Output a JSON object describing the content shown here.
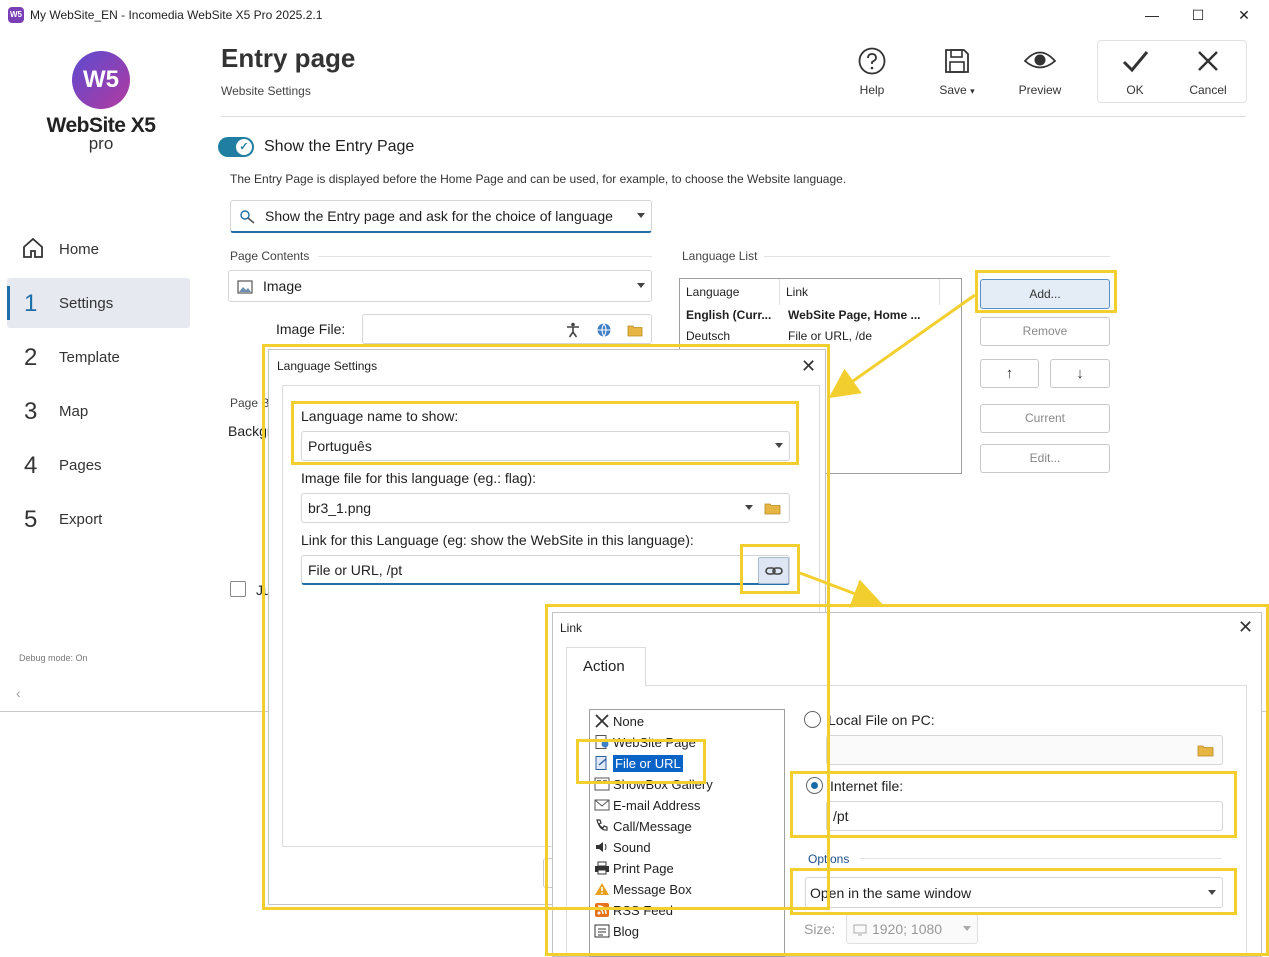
{
  "window": {
    "title": "My WebSite_EN - Incomedia WebSite X5 Pro 2025.2.1",
    "app_icon_text": "W5",
    "minimize": "—",
    "maximize": "☐",
    "close": "✕"
  },
  "logo": {
    "mark": "W5",
    "name": "WebSite X5",
    "edition": "pro"
  },
  "nav": [
    {
      "num": "",
      "label": "Home"
    },
    {
      "num": "1",
      "label": "Settings"
    },
    {
      "num": "2",
      "label": "Template"
    },
    {
      "num": "3",
      "label": "Map"
    },
    {
      "num": "4",
      "label": "Pages"
    },
    {
      "num": "5",
      "label": "Export"
    }
  ],
  "debug_mode": "Debug mode: On",
  "collapse_glyph": "‹",
  "header": {
    "title": "Entry page",
    "subtitle": "Website Settings"
  },
  "toolbar": {
    "help": "Help",
    "save": "Save",
    "save_caret": "▾",
    "preview": "Preview",
    "ok": "OK",
    "cancel": "Cancel"
  },
  "entry": {
    "toggle_label": "Show the Entry Page",
    "toggle_check": "✓",
    "description": "The Entry Page is displayed before the Home Page and can be used, for example, to choose the Website language.",
    "mode_value": "Show the Entry page and ask for the choice of language",
    "page_contents_label": "Page Contents",
    "page_contents_value": "Image",
    "image_file_label": "Image File:",
    "image_file_value": "",
    "page_bg_label_partial": "Page Ba",
    "background_label_partial": "Backgr",
    "checkbox_label_partial": "Ju"
  },
  "language_list": {
    "label": "Language List",
    "columns": [
      "Language",
      "Link"
    ],
    "rows": [
      {
        "language": "English (Curr...",
        "link": "WebSite Page, Home ...",
        "bold": true
      },
      {
        "language": "Deutsch",
        "link": "File or URL, /de",
        "bold": false
      }
    ],
    "buttons": {
      "add": "Add...",
      "remove": "Remove",
      "up": "↑",
      "down": "↓",
      "current": "Current",
      "edit": "Edit..."
    }
  },
  "language_dialog": {
    "title": "Language Settings",
    "close": "✕",
    "name_label": "Language name to show:",
    "name_value": "Português",
    "image_label": "Image file for this language (eg.: flag):",
    "image_value": "br3_1.png",
    "link_label": "Link for this Language (eg: show the WebSite in this language):",
    "link_value": "File or URL, /pt"
  },
  "link_dialog": {
    "title": "Link",
    "close": "✕",
    "tab": "Action",
    "actions": [
      "None",
      "WebSite Page",
      "File or URL",
      "ShowBox Gallery",
      "E-mail Address",
      "Call/Message",
      "Sound",
      "Print Page",
      "Message Box",
      "RSS Feed",
      "Blog"
    ],
    "selected_action": "File or URL",
    "local_file_label": "Local File on PC:",
    "local_file_value": "",
    "internet_file_label": "Internet file:",
    "internet_file_value": "/pt",
    "options_label": "Options",
    "open_mode_value": "Open in the same window",
    "size_label": "Size:",
    "size_value": "1920; 1080"
  },
  "colors": {
    "accent": "#1e6fa8",
    "highlight": "#f2cf2f",
    "selection": "#0a64c8",
    "toggle": "#1f7ea1"
  }
}
